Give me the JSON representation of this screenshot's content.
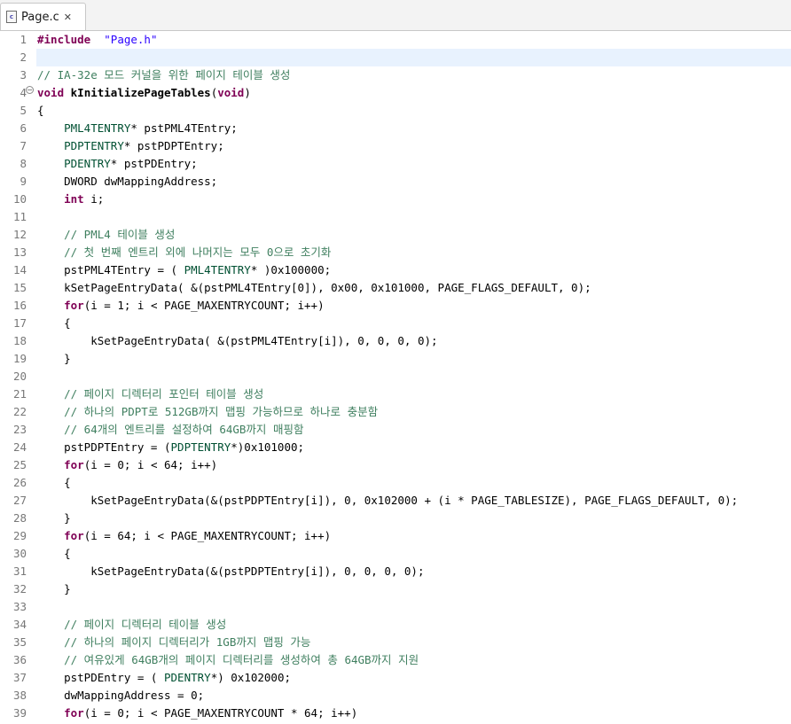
{
  "tab": {
    "title": "Page.c",
    "close_glyph": "✕",
    "icon": "c-source-file-icon"
  },
  "editor": {
    "current_line": 2,
    "lines": [
      [
        [
          "pp",
          "#include"
        ],
        [
          "",
          "  "
        ],
        [
          "str",
          "\"Page.h\""
        ]
      ],
      [],
      [
        [
          "cm",
          "// IA-32e 모드 커널을 위한 페이지 테이블 생성"
        ]
      ],
      [
        [
          "kw",
          "void"
        ],
        [
          "",
          " "
        ],
        [
          "fn",
          "kInitializePageTables"
        ],
        [
          "",
          "("
        ],
        [
          "kw",
          "void"
        ],
        [
          "",
          ")"
        ]
      ],
      [
        [
          "",
          "{"
        ]
      ],
      [
        [
          "",
          "    "
        ],
        [
          "ty",
          "PML4TENTRY"
        ],
        [
          "",
          "* pstPML4TEntry;"
        ]
      ],
      [
        [
          "",
          "    "
        ],
        [
          "ty",
          "PDPTENTRY"
        ],
        [
          "",
          "* pstPDPTEntry;"
        ]
      ],
      [
        [
          "",
          "    "
        ],
        [
          "ty",
          "PDENTRY"
        ],
        [
          "",
          "* pstPDEntry;"
        ]
      ],
      [
        [
          "",
          "    DWORD dwMappingAddress;"
        ]
      ],
      [
        [
          "",
          "    "
        ],
        [
          "kw",
          "int"
        ],
        [
          "",
          " i;"
        ]
      ],
      [],
      [
        [
          "",
          "    "
        ],
        [
          "cm",
          "// PML4 테이블 생성"
        ]
      ],
      [
        [
          "",
          "    "
        ],
        [
          "cm",
          "// 첫 번째 엔트리 외에 나머지는 모두 0으로 초기화"
        ]
      ],
      [
        [
          "",
          "    pstPML4TEntry = ( "
        ],
        [
          "ty",
          "PML4TENTRY"
        ],
        [
          "",
          "* )0x100000;"
        ]
      ],
      [
        [
          "",
          "    kSetPageEntryData( &(pstPML4TEntry[0]), 0x00, 0x101000, PAGE_FLAGS_DEFAULT, 0);"
        ]
      ],
      [
        [
          "",
          "    "
        ],
        [
          "kw",
          "for"
        ],
        [
          "",
          "(i = 1; i < PAGE_MAXENTRYCOUNT; i++)"
        ]
      ],
      [
        [
          "",
          "    {"
        ]
      ],
      [
        [
          "",
          "        kSetPageEntryData( &(pstPML4TEntry[i]), 0, 0, 0, 0);"
        ]
      ],
      [
        [
          "",
          "    }"
        ]
      ],
      [],
      [
        [
          "",
          "    "
        ],
        [
          "cm",
          "// 페이지 디렉터리 포인터 테이블 생성"
        ]
      ],
      [
        [
          "",
          "    "
        ],
        [
          "cm",
          "// 하나의 PDPT로 512GB까지 맵핑 가능하므로 하나로 충분함"
        ]
      ],
      [
        [
          "",
          "    "
        ],
        [
          "cm",
          "// 64개의 엔트리를 설정하여 64GB까지 매핑함"
        ]
      ],
      [
        [
          "",
          "    pstPDPTEntry = ("
        ],
        [
          "ty",
          "PDPTENTRY"
        ],
        [
          "",
          "*)0x101000;"
        ]
      ],
      [
        [
          "",
          "    "
        ],
        [
          "kw",
          "for"
        ],
        [
          "",
          "(i = 0; i < 64; i++)"
        ]
      ],
      [
        [
          "",
          "    {"
        ]
      ],
      [
        [
          "",
          "        kSetPageEntryData(&(pstPDPTEntry[i]), 0, 0x102000 + (i * PAGE_TABLESIZE), PAGE_FLAGS_DEFAULT, 0);"
        ]
      ],
      [
        [
          "",
          "    }"
        ]
      ],
      [
        [
          "",
          "    "
        ],
        [
          "kw",
          "for"
        ],
        [
          "",
          "(i = 64; i < PAGE_MAXENTRYCOUNT; i++)"
        ]
      ],
      [
        [
          "",
          "    {"
        ]
      ],
      [
        [
          "",
          "        kSetPageEntryData(&(pstPDPTEntry[i]), 0, 0, 0, 0);"
        ]
      ],
      [
        [
          "",
          "    }"
        ]
      ],
      [],
      [
        [
          "",
          "    "
        ],
        [
          "cm",
          "// 페이지 디렉터리 테이블 생성"
        ]
      ],
      [
        [
          "",
          "    "
        ],
        [
          "cm",
          "// 하나의 페이지 디렉터리가 1GB까지 맵핑 가능"
        ]
      ],
      [
        [
          "",
          "    "
        ],
        [
          "cm",
          "// 여유있게 64GB개의 페이지 디렉터리를 생성하여 총 64GB까지 지원"
        ]
      ],
      [
        [
          "",
          "    pstPDEntry = ( "
        ],
        [
          "ty",
          "PDENTRY"
        ],
        [
          "",
          "*) 0x102000;"
        ]
      ],
      [
        [
          "",
          "    dwMappingAddress = 0;"
        ]
      ],
      [
        [
          "",
          "    "
        ],
        [
          "kw",
          "for"
        ],
        [
          "",
          "(i = 0; i < PAGE_MAXENTRYCOUNT * 64; i++)"
        ]
      ]
    ]
  }
}
